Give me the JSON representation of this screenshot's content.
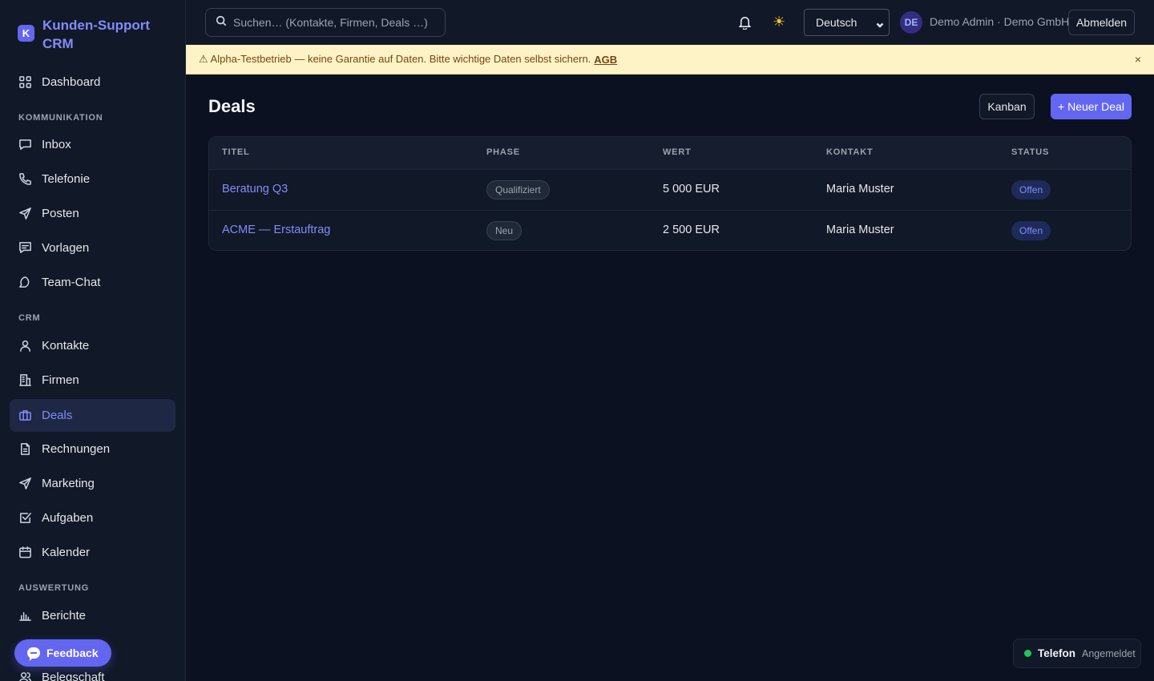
{
  "brand": {
    "logo": "K",
    "name": "Kunden-Support CRM"
  },
  "sidebar": {
    "dashboard": "Dashboard",
    "sections": {
      "kommunikation": "KOMMUNIKATION",
      "crm": "CRM",
      "auswertung": "AUSWERTUNG"
    },
    "items": [
      {
        "label": "Inbox",
        "icon": "inbox-icon"
      },
      {
        "label": "Telefonie",
        "icon": "phone-icon"
      },
      {
        "label": "Posten",
        "icon": "send-icon"
      },
      {
        "label": "Vorlagen",
        "icon": "template-icon"
      },
      {
        "label": "Team-Chat",
        "icon": "chat-icon"
      },
      {
        "label": "Kontakte",
        "icon": "user-icon"
      },
      {
        "label": "Firmen",
        "icon": "building-icon"
      },
      {
        "label": "Deals",
        "icon": "briefcase-icon",
        "active": true
      },
      {
        "label": "Rechnungen",
        "icon": "invoice-icon"
      },
      {
        "label": "Marketing",
        "icon": "send-icon"
      },
      {
        "label": "Aufgaben",
        "icon": "checkbox-icon"
      },
      {
        "label": "Kalender",
        "icon": "calendar-icon"
      },
      {
        "label": "Berichte",
        "icon": "bar-chart-icon"
      },
      {
        "label": "Belegschaft",
        "icon": "users-icon"
      }
    ],
    "feedback": "Feedback"
  },
  "header": {
    "search_placeholder": "Suchen… (Kontakte, Firmen, Deals …)",
    "language": "Deutsch",
    "avatar_initials": "DE",
    "user_label": "Demo Admin · Demo GmbH",
    "logout": "Abmelden"
  },
  "banner": {
    "text": "⚠ Alpha-Testbetrieb — keine Garantie auf Daten. Bitte wichtige Daten selbst sichern.",
    "link": "AGB",
    "close": "×"
  },
  "main": {
    "title": "Deals",
    "kanban_button": "Kanban",
    "new_deal_button": "+ Neuer Deal",
    "columns": [
      "TITEL",
      "PHASE",
      "WERT",
      "KONTAKT",
      "STATUS"
    ],
    "rows": [
      {
        "title": "Beratung Q3",
        "phase": "Qualifiziert",
        "value": "5 000 EUR",
        "contact": "Maria Muster",
        "status": "Offen"
      },
      {
        "title": "ACME — Erstauftrag",
        "phase": "Neu",
        "value": "2 500 EUR",
        "contact": "Maria Muster",
        "status": "Offen"
      }
    ]
  },
  "phone_widget": {
    "label": "Telefon",
    "status": "Angemeldet"
  },
  "colors": {
    "accent": "#6366f1",
    "accent_text": "#818cf8",
    "background": "#0b1120",
    "banner": "#fdf3c7",
    "online": "#22c55e"
  }
}
